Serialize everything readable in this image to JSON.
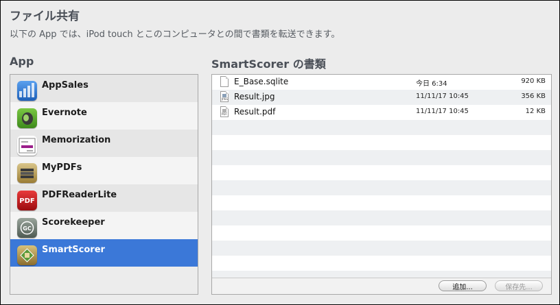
{
  "header": {
    "title": "ファイル共有",
    "description": "以下の App では、iPod touch とこのコンピュータとの間で書類を転送できます。"
  },
  "apps": {
    "heading": "App",
    "items": [
      {
        "label": "AppSales",
        "icon": "appsales-icon",
        "color": "#2a6fc9"
      },
      {
        "label": "Evernote",
        "icon": "evernote-icon",
        "color": "#6fb33a"
      },
      {
        "label": "Memorization",
        "icon": "memorization-icon",
        "color": "#ffffff"
      },
      {
        "label": "MyPDFs",
        "icon": "mypdfs-icon",
        "color": "#b89a45"
      },
      {
        "label": "PDFReaderLite",
        "icon": "pdfreaderlite-icon",
        "color": "#c3151b"
      },
      {
        "label": "Scorekeeper",
        "icon": "scorekeeper-icon",
        "color": "#6e7a70"
      },
      {
        "label": "SmartScorer",
        "icon": "smartscorer-icon",
        "color": "#9a8040"
      }
    ],
    "selected_index": 6
  },
  "documents": {
    "heading": "SmartScorer の書類",
    "files": [
      {
        "name": "E_Base.sqlite",
        "date": "今日 6:34",
        "size": "920 KB",
        "icon": "document-icon"
      },
      {
        "name": "Result.jpg",
        "date": "11/11/17 10:45",
        "size": "356 KB",
        "icon": "jpeg-file-icon"
      },
      {
        "name": "Result.pdf",
        "date": "11/11/17 10:45",
        "size": "12 KB",
        "icon": "pdf-file-icon"
      }
    ]
  },
  "buttons": {
    "add_label": "追加...",
    "save_label": "保存先..."
  },
  "colors": {
    "selection": "#3b78d8",
    "window_bg": "#ececec"
  }
}
